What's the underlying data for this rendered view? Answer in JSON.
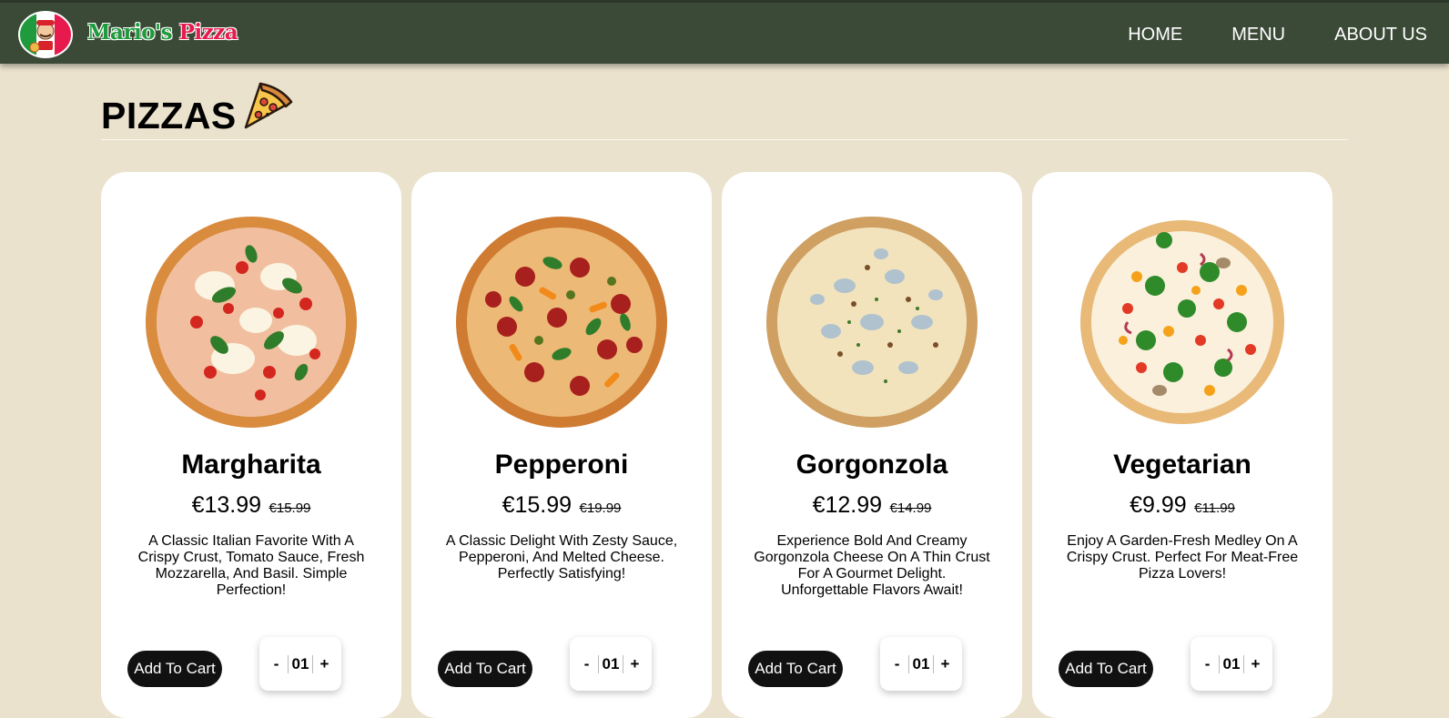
{
  "brand": {
    "name_part1": "Mario's",
    "name_part2": "Pizza"
  },
  "nav": {
    "items": [
      "HOME",
      "MENU",
      "ABOUT US"
    ]
  },
  "section": {
    "title": "PIZZAS"
  },
  "colors": {
    "navbar": "#3b4a37",
    "page_background": "#ebe2cd",
    "card_background": "#ffffff",
    "button_background": "#111111",
    "brand_green": "#1f9a3c",
    "brand_red": "#e8194d"
  },
  "products": [
    {
      "name": "Margharita",
      "price": "€13.99",
      "old_price": "€15.99",
      "description": "A Classic Italian Favorite With A Crispy Crust, Tomato Sauce, Fresh Mozzarella, And Basil. Simple Perfection!",
      "button_label": "Add To Cart",
      "quantity": "01",
      "minus": "-",
      "plus": "+",
      "image": "margherita-pizza-image"
    },
    {
      "name": "Pepperoni",
      "price": "€15.99",
      "old_price": "€19.99",
      "description": "A Classic Delight With Zesty Sauce, Pepperoni, And Melted Cheese. Perfectly Satisfying!",
      "button_label": "Add To Cart",
      "quantity": "01",
      "minus": "-",
      "plus": "+",
      "image": "pepperoni-pizza-image"
    },
    {
      "name": "Gorgonzola",
      "price": "€12.99",
      "old_price": "€14.99",
      "description": "Experience Bold And Creamy Gorgonzola Cheese On A Thin Crust For A Gourmet Delight. Unforgettable Flavors Await!",
      "button_label": "Add To Cart",
      "quantity": "01",
      "minus": "-",
      "plus": "+",
      "image": "gorgonzola-pizza-image"
    },
    {
      "name": "Vegetarian",
      "price": "€9.99",
      "old_price": "€11.99",
      "description": "Enjoy A Garden-Fresh Medley On A Crispy Crust. Perfect For Meat-Free Pizza Lovers!",
      "button_label": "Add To Cart",
      "quantity": "01",
      "minus": "-",
      "plus": "+",
      "image": "vegetarian-pizza-image"
    }
  ]
}
